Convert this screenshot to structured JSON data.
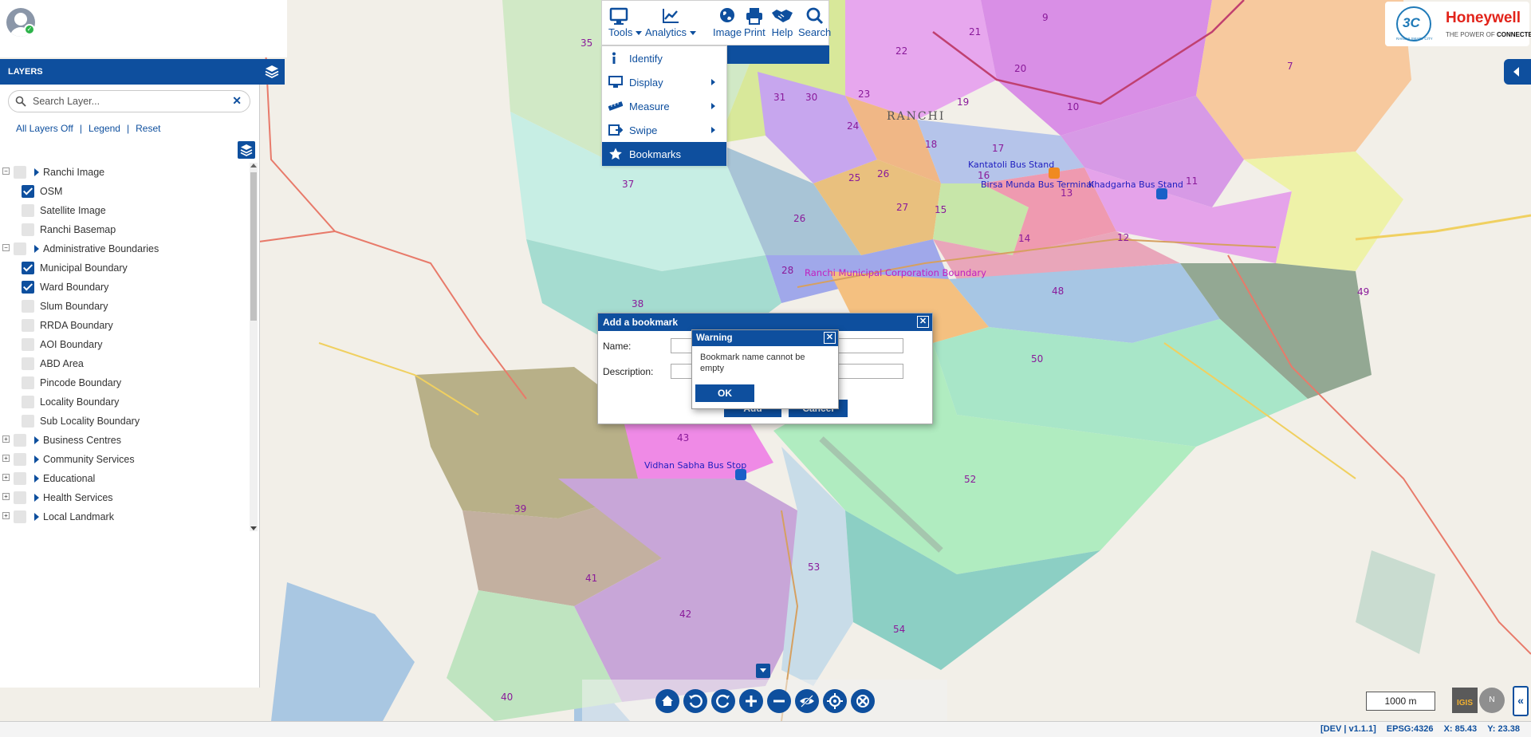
{
  "toolbar": {
    "items": [
      {
        "label": "Tools",
        "icon": "monitor-icon"
      },
      {
        "label": "Analytics",
        "icon": "chart-icon"
      },
      {
        "label": "Image",
        "icon": "globe-icon"
      },
      {
        "label": "Print",
        "icon": "printer-icon"
      },
      {
        "label": "Help",
        "icon": "handshake-icon"
      },
      {
        "label": "Search",
        "icon": "search-icon"
      }
    ]
  },
  "tools_menu": [
    {
      "label": "Identify",
      "icon": "info-icon",
      "has_sub": false,
      "active": false
    },
    {
      "label": "Display",
      "icon": "monitor-icon",
      "has_sub": true,
      "active": false
    },
    {
      "label": "Measure",
      "icon": "ruler-icon",
      "has_sub": true,
      "active": false
    },
    {
      "label": "Swipe",
      "icon": "swipe-icon",
      "has_sub": true,
      "active": false
    },
    {
      "label": "Bookmarks",
      "icon": "star-icon",
      "has_sub": false,
      "active": true
    }
  ],
  "layers": {
    "title": "LAYERS",
    "search_placeholder": "Search Layer...",
    "links": {
      "off": "All Layers Off",
      "legend": "Legend",
      "reset": "Reset"
    },
    "tree": [
      {
        "type": "group",
        "label": "Ranchi Image",
        "checked": false
      },
      {
        "type": "leaf",
        "label": "OSM",
        "checked": true
      },
      {
        "type": "leaf",
        "label": "Satellite Image",
        "checked": false
      },
      {
        "type": "leaf",
        "label": "Ranchi Basemap",
        "checked": false
      },
      {
        "type": "group",
        "label": "Administrative Boundaries",
        "checked": false
      },
      {
        "type": "leaf",
        "label": "Municipal Boundary",
        "checked": true
      },
      {
        "type": "leaf",
        "label": "Ward Boundary",
        "checked": true
      },
      {
        "type": "leaf",
        "label": "Slum Boundary",
        "checked": false
      },
      {
        "type": "leaf",
        "label": "RRDA Boundary",
        "checked": false
      },
      {
        "type": "leaf",
        "label": "AOI Boundary",
        "checked": false
      },
      {
        "type": "leaf",
        "label": "ABD Area",
        "checked": false
      },
      {
        "type": "leaf",
        "label": "Pincode Boundary",
        "checked": false
      },
      {
        "type": "leaf",
        "label": "Locality Boundary",
        "checked": false
      },
      {
        "type": "leaf",
        "label": "Sub Locality Boundary",
        "checked": false
      },
      {
        "type": "group",
        "label": "Business Centres",
        "checked": false,
        "expandable": true
      },
      {
        "type": "group",
        "label": "Community Services",
        "checked": false,
        "expandable": true
      },
      {
        "type": "group",
        "label": "Educational",
        "checked": false,
        "expandable": true
      },
      {
        "type": "group",
        "label": "Health Services",
        "checked": false,
        "expandable": true
      },
      {
        "type": "group",
        "label": "Local Landmark",
        "checked": false,
        "expandable": true
      }
    ]
  },
  "logo": {
    "circle_text": "3C",
    "circle_sub": "RANCHI SMART CITY",
    "brand": "Honeywell",
    "tagline_plain": "THE POWER OF ",
    "tagline_bold": "CONNECTED"
  },
  "bookmark_dialog": {
    "title": "Add a bookmark",
    "name_label": "Name:",
    "description_label": "Description:",
    "name_value": "",
    "description_value": "",
    "add_label": "Add",
    "cancel_label": "Cancel"
  },
  "warning_dialog": {
    "title": "Warning",
    "message": "Bookmark name cannot be empty",
    "ok_label": "OK"
  },
  "map": {
    "city_label": "RANCHI",
    "corporation_label": "Ranchi Municipal Corporation Boundary",
    "places": [
      "Khadgarha Bus Stand",
      "Birsa Munda Bus Terminal",
      "Kantatoli Bus Stand",
      "Vidhan Sabha Bus Stop"
    ],
    "ward_numbers": [
      "35",
      "22",
      "21",
      "9",
      "7",
      "23",
      "20",
      "31",
      "30",
      "19",
      "10",
      "24",
      "18",
      "17",
      "16",
      "13",
      "11",
      "25",
      "26",
      "27",
      "15",
      "37",
      "26",
      "14",
      "12",
      "28",
      "48",
      "49",
      "38",
      "50",
      "43",
      "52",
      "39",
      "41",
      "42",
      "53",
      "54",
      "40"
    ],
    "scale": "1000 m",
    "igis": "IGIS",
    "north": "N"
  },
  "nav_buttons": [
    "home-icon",
    "undo-icon",
    "redo-icon",
    "zoom-in-icon",
    "zoom-out-icon",
    "hide-icon",
    "locate-icon",
    "clear-icon"
  ],
  "status": {
    "version": "[DEV | v1.1.1]",
    "epsg": "EPSG:4326",
    "x": "X: 85.43",
    "y": "Y: 23.38"
  }
}
